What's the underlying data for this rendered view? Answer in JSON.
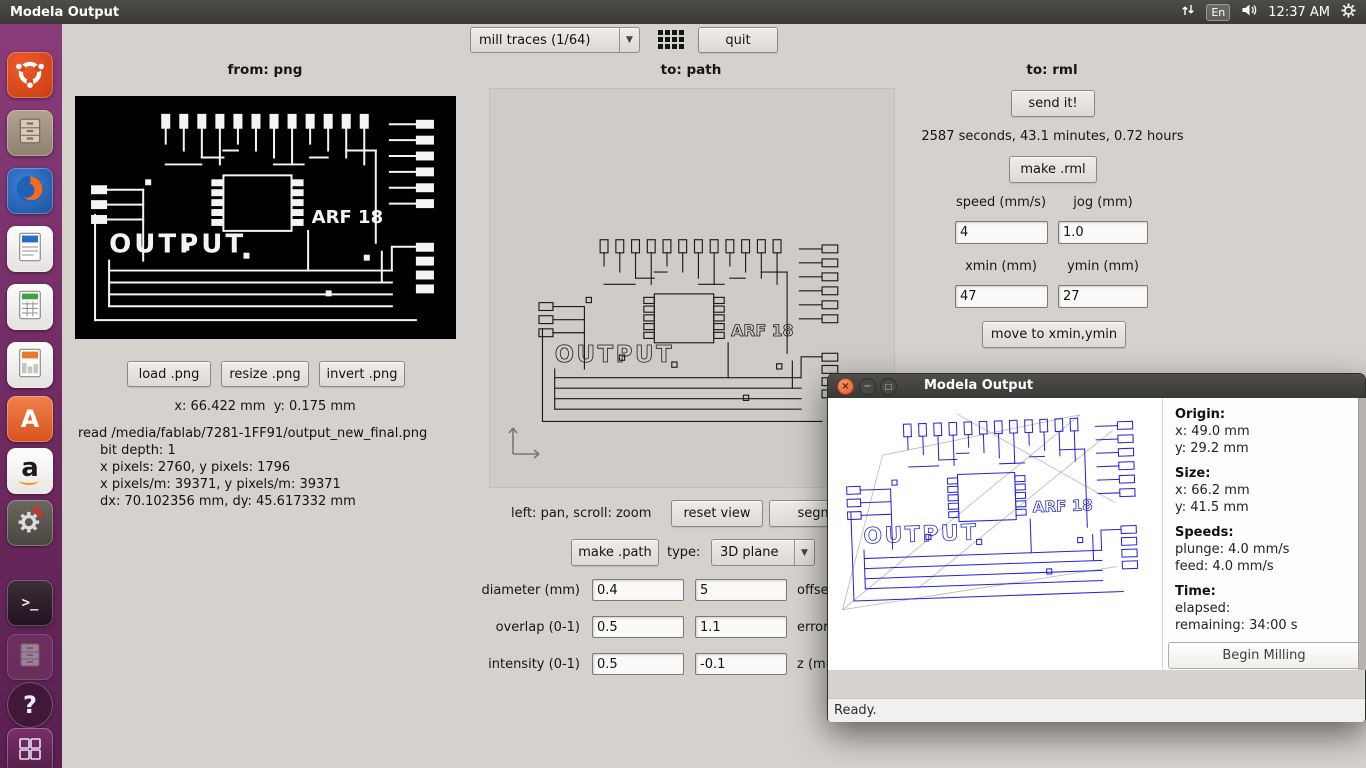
{
  "topbar": {
    "title": "Modela Output",
    "keyboard": "En",
    "clock": "12:37 AM"
  },
  "launcher": {
    "items": [
      {
        "id": "ubuntu-dash",
        "label": "Ubuntu Dash"
      },
      {
        "id": "files",
        "label": "Files"
      },
      {
        "id": "firefox",
        "label": "Firefox"
      },
      {
        "id": "libreoffice-writer",
        "label": "LibreOffice Writer"
      },
      {
        "id": "libreoffice-calc",
        "label": "LibreOffice Calc"
      },
      {
        "id": "libreoffice-impress",
        "label": "LibreOffice Impress"
      },
      {
        "id": "ubuntu-software",
        "label": "Ubuntu Software"
      },
      {
        "id": "amazon",
        "label": "Amazon"
      },
      {
        "id": "system-settings",
        "label": "System Settings"
      },
      {
        "id": "terminal",
        "label": "Terminal"
      },
      {
        "id": "archive",
        "label": "Archive"
      },
      {
        "id": "help",
        "label": "Help"
      },
      {
        "id": "workspaces",
        "label": "Workspace Switcher"
      }
    ]
  },
  "toolbar": {
    "process_select": "mill traces (1/64)",
    "quit": "quit"
  },
  "columns": {
    "from_png": "from: png",
    "to_path": "to: path",
    "to_rml": "to: rml"
  },
  "png": {
    "buttons": {
      "load": "load .png",
      "resize": "resize .png",
      "invert": "invert .png"
    },
    "coords_x": "x: 66.422 mm",
    "coords_y": "y: 0.175 mm",
    "info": [
      "read /media/fablab/7281-1FF91/output_new_final.png",
      "bit depth: 1",
      "x pixels: 2760, y pixels: 1796",
      "x pixels/m: 39371, y pixels/m: 39371",
      "dx: 70.102356 mm, dy: 45.617332 mm"
    ],
    "image_labels": {
      "output": "OUTPUT",
      "arf": "ARF 18"
    }
  },
  "path": {
    "hint": "left: pan, scroll: zoom",
    "reset_view": "reset view",
    "segment": "segment",
    "make_path": "make .path",
    "type_label": "type:",
    "type_value": "3D plane",
    "params": [
      {
        "label": "diameter (mm)",
        "value1": "0.4",
        "value2": "5",
        "label2": "offsets"
      },
      {
        "label": "overlap (0-1)",
        "value1": "0.5",
        "value2": "1.1",
        "label2": "error ("
      },
      {
        "label": "intensity (0-1)",
        "value1": "0.5",
        "value2": "-0.1",
        "label2": "z (mm)"
      }
    ]
  },
  "rml": {
    "send_it": "send it!",
    "time_estimate": "2587 seconds, 43.1 minutes, 0.72 hours",
    "make_rml": "make .rml",
    "speed_label": "speed (mm/s)",
    "jog_label": "jog (mm)",
    "speed_value": "4",
    "jog_value": "1.0",
    "xmin_label": "xmin (mm)",
    "ymin_label": "ymin (mm)",
    "xmin_value": "47",
    "ymin_value": "27",
    "move_button": "move to xmin,ymin"
  },
  "dialog": {
    "title": "Modela Output",
    "info": [
      {
        "header": "Origin:",
        "lines": [
          "x: 49.0 mm",
          "y: 29.2 mm"
        ]
      },
      {
        "header": "Size:",
        "lines": [
          "x: 66.2 mm",
          "y: 41.5 mm"
        ]
      },
      {
        "header": "Speeds:",
        "lines": [
          "plunge: 4.0 mm/s",
          "feed: 4.0 mm/s"
        ]
      },
      {
        "header": "Time:",
        "lines": [
          "elapsed:",
          "remaining: 34:00 s"
        ]
      }
    ],
    "begin_button": "Begin Milling",
    "status": "Ready."
  },
  "colors": {
    "accent_orange": "#E95420",
    "path_blue": "#2222dd",
    "launcher_purple": "#6e2a60",
    "panel_dark": "#3a3935"
  }
}
